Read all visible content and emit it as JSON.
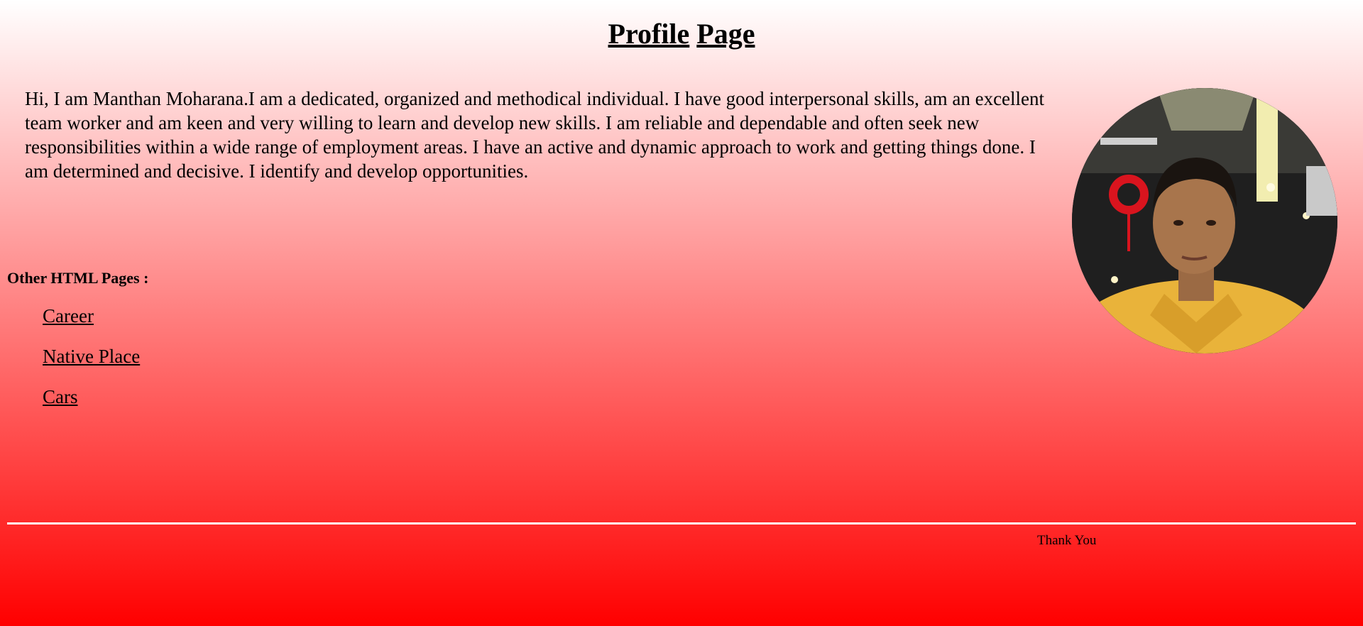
{
  "header": {
    "title_word1": "Profile",
    "title_word2": "Page"
  },
  "bio": {
    "text": "Hi, I am Manthan Moharana.I am a dedicated, organized and methodical individual. I have good interpersonal skills, am an excellent team worker and am keen and very willing to learn and develop new skills. I am reliable and dependable and often seek new responsibilities within a wide range of employment areas. I have an active and dynamic approach to work and getting things done. I am determined and decisive. I identify and develop opportunities."
  },
  "photo": {
    "icon": "profile-photo"
  },
  "nav": {
    "heading": "Other HTML Pages :",
    "links": [
      {
        "label": "Career"
      },
      {
        "label": "Native Place"
      },
      {
        "label": "Cars"
      }
    ]
  },
  "footer": {
    "text": "Thank You"
  },
  "colors": {
    "gradient_top": "#ffffff",
    "gradient_bottom": "#ff0000",
    "rule": "#ffffff"
  }
}
